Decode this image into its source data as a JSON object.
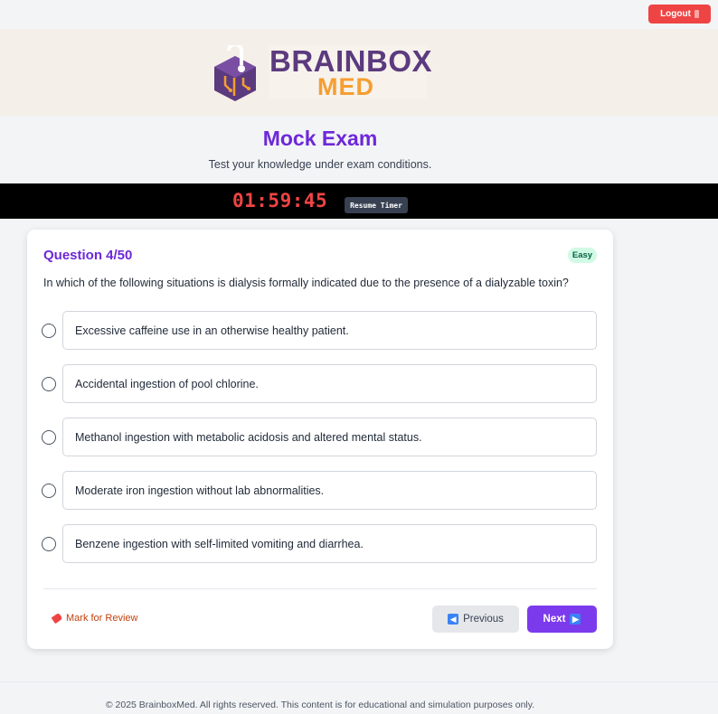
{
  "topbar": {
    "logout_label": "Logout"
  },
  "brand": {
    "line1": "BRAINBOX",
    "line2": "MED"
  },
  "header": {
    "title": "Mock Exam",
    "subtitle": "Test your knowledge under exam conditions."
  },
  "timer": {
    "display": "01:59:45",
    "resume_label": "Resume Timer"
  },
  "question": {
    "number_label": "Question 4/50",
    "difficulty": "Easy",
    "text": "In which of the following situations is dialysis formally indicated due to the presence of a dialyzable toxin?",
    "options": [
      {
        "label": "Excessive caffeine use in an otherwise healthy patient."
      },
      {
        "label": "Accidental ingestion of pool chlorine."
      },
      {
        "label": "Methanol ingestion with metabolic acidosis and altered mental status."
      },
      {
        "label": "Moderate iron ingestion without lab abnormalities."
      },
      {
        "label": "Benzene ingestion with self-limited vomiting and diarrhea."
      }
    ]
  },
  "actions": {
    "mark_review_label": "Mark for Review",
    "previous_label": "Previous",
    "next_label": "Next"
  },
  "footer": {
    "text": "© 2025 BrainboxMed. All rights reserved. This content is for educational and simulation purposes only."
  },
  "colors": {
    "accent": "#7c3aed",
    "title": "#6d28d9",
    "danger": "#ef4444",
    "badge_bg": "#d1fae5",
    "brand_purple": "#5b3a7e",
    "brand_orange": "#f59e32"
  }
}
